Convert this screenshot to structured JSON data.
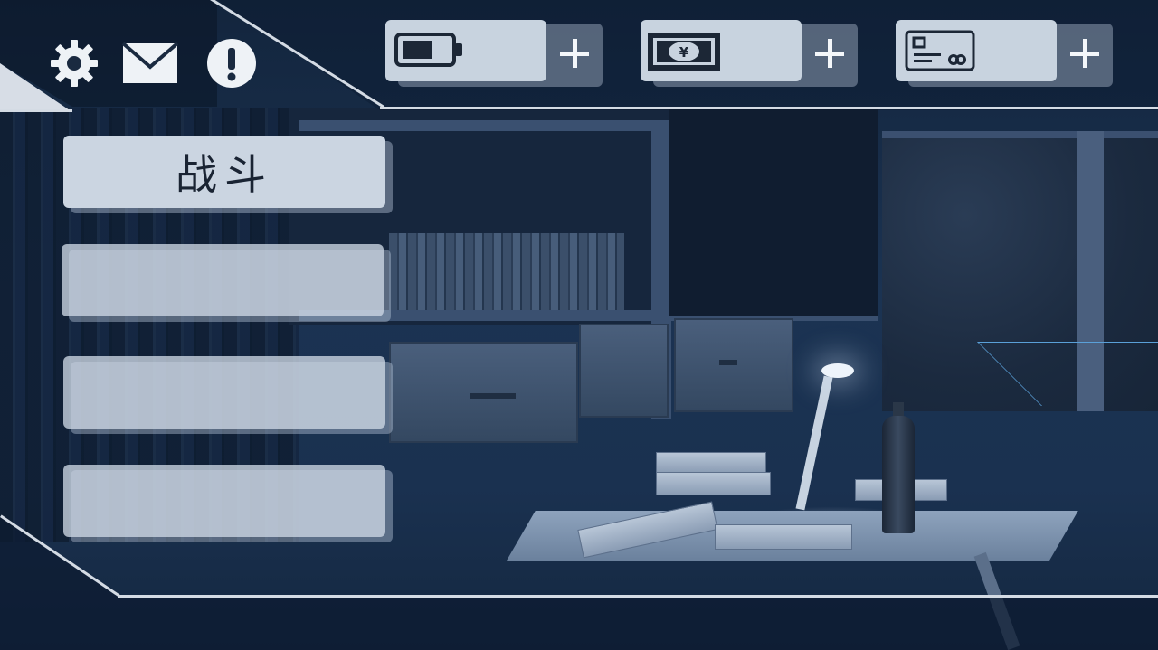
{
  "top_left_icons": [
    {
      "name": "settings",
      "icon": "gear-icon"
    },
    {
      "name": "mail",
      "icon": "envelope-icon"
    },
    {
      "name": "notice",
      "icon": "exclamation-icon"
    }
  ],
  "resources": [
    {
      "name": "energy",
      "icon": "battery-icon",
      "value": "",
      "add": "+"
    },
    {
      "name": "currency",
      "icon": "yen-banknote-icon",
      "currency_symbol": "¥",
      "value": "",
      "add": "+"
    },
    {
      "name": "card",
      "icon": "card-icon",
      "value": "",
      "add": "+"
    }
  ],
  "menu": {
    "items": [
      {
        "label": "战斗"
      },
      {
        "label": ""
      },
      {
        "label": ""
      },
      {
        "label": ""
      }
    ]
  },
  "colors": {
    "ui_light": "#c8d3df",
    "ui_line": "#d4dbe4",
    "scene_dark": "#13253d",
    "accent_blue": "#5aa0d8"
  }
}
